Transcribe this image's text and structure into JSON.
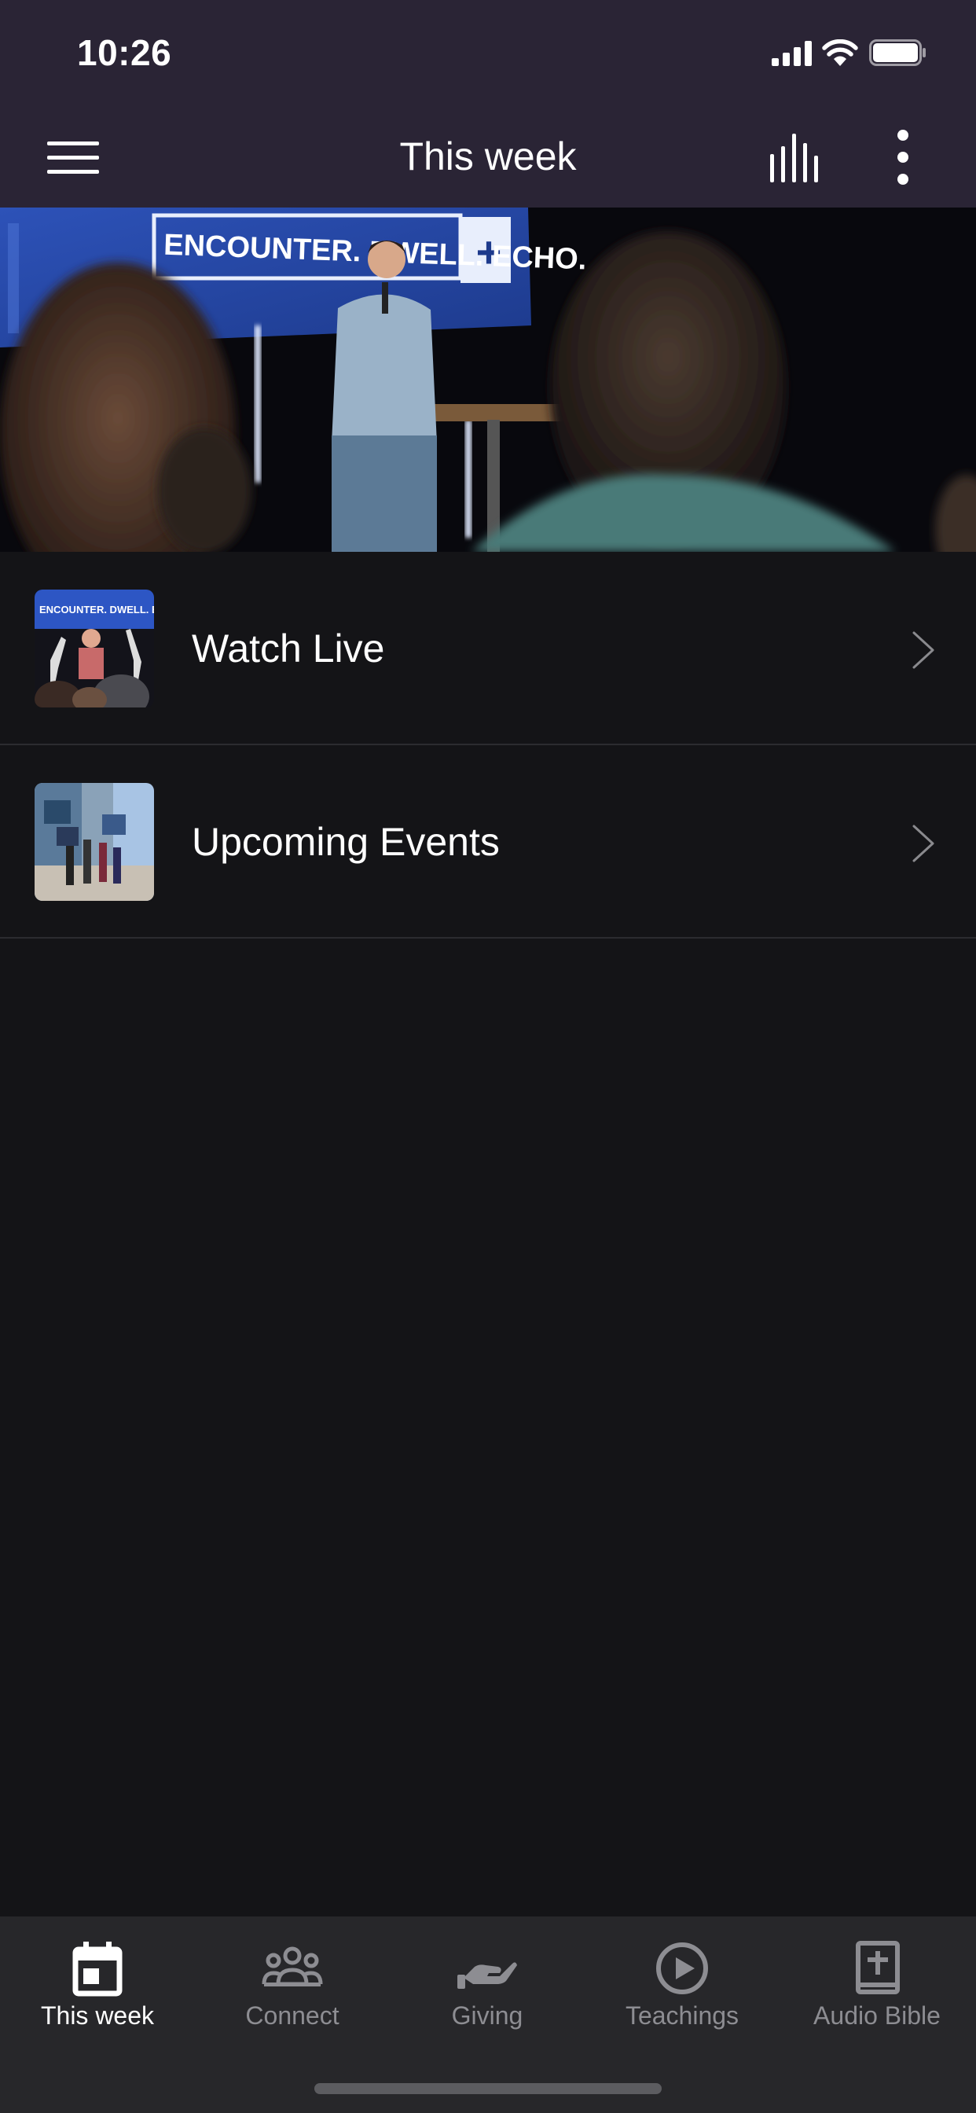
{
  "status_bar": {
    "time": "10:26"
  },
  "nav": {
    "title": "This week",
    "menu_icon": "hamburger-menu-icon",
    "audio_icon": "audio-bars-icon",
    "more_icon": "vertical-dots-icon"
  },
  "hero": {
    "sign_text": "ENCOUNTER. DWELL. ECHO."
  },
  "list": {
    "items": [
      {
        "label": "Watch Live",
        "thumb_sign": "ENCOUNTER. DWELL. ECHO."
      },
      {
        "label": "Upcoming Events"
      }
    ]
  },
  "tab_bar": {
    "tabs": [
      {
        "label": "This week",
        "icon": "calendar-icon",
        "active": true
      },
      {
        "label": "Connect",
        "icon": "people-group-icon",
        "active": false
      },
      {
        "label": "Giving",
        "icon": "giving-hand-icon",
        "active": false
      },
      {
        "label": "Teachings",
        "icon": "play-circle-icon",
        "active": false
      },
      {
        "label": "Audio Bible",
        "icon": "bible-cross-icon",
        "active": false
      }
    ]
  },
  "colors": {
    "header_bg": "#2a2435",
    "body_bg": "#141417",
    "tab_bar_bg": "#27272a",
    "tab_active": "#ffffff",
    "tab_inactive": "#8d8d92"
  }
}
